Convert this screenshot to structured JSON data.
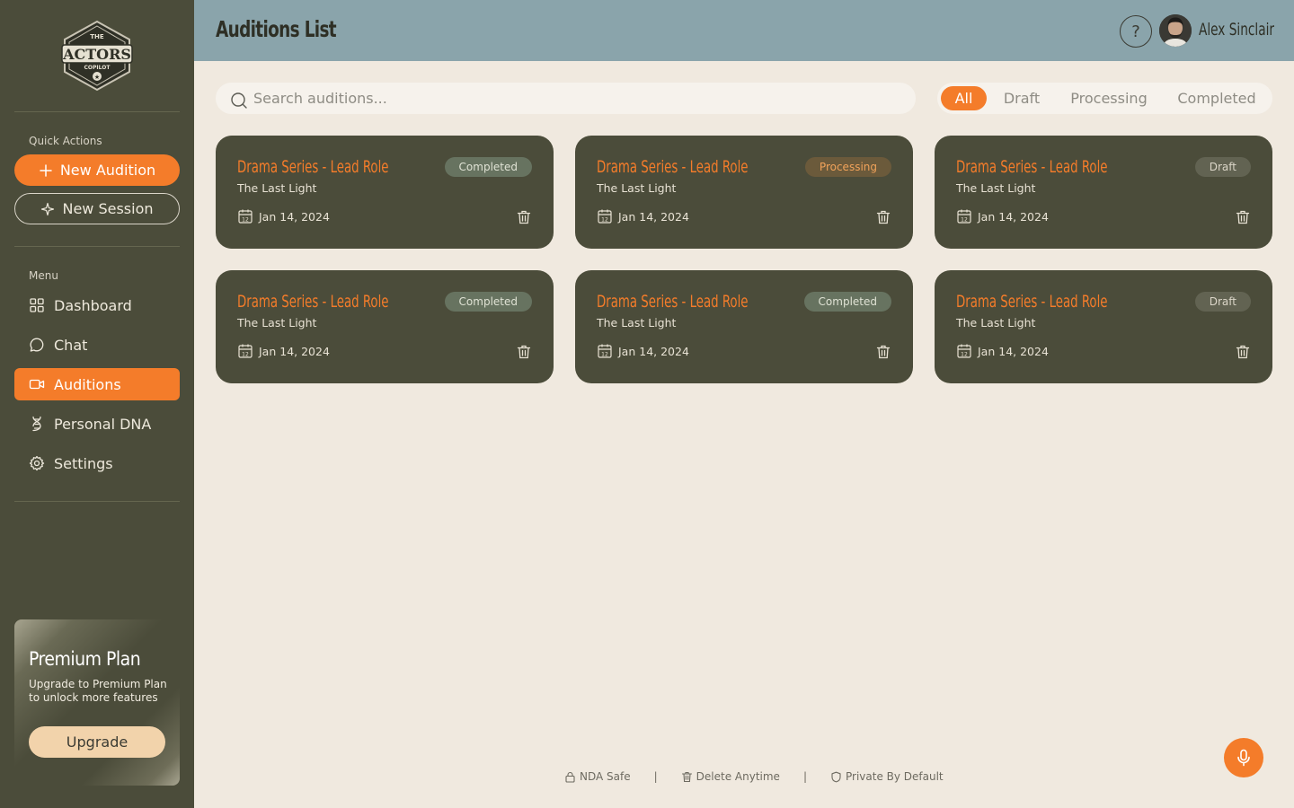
{
  "app": {
    "logo_text": {
      "top": "THE",
      "main": "ACTORS",
      "bottom": "COPILOT"
    }
  },
  "sidebar": {
    "quick_actions_label": "Quick Actions",
    "new_audition_label": "New Audition",
    "new_session_label": "New Session",
    "menu_label": "Menu",
    "items": [
      {
        "label": "Dashboard",
        "icon": "dashboard-icon",
        "active": false
      },
      {
        "label": "Chat",
        "icon": "chat-icon",
        "active": false
      },
      {
        "label": "Auditions",
        "icon": "video-icon",
        "active": true
      },
      {
        "label": "Personal DNA",
        "icon": "dna-icon",
        "active": false
      },
      {
        "label": "Settings",
        "icon": "gear-icon",
        "active": false
      }
    ],
    "premium": {
      "title": "Premium Plan",
      "description": "Upgrade to Premium Plan to unlock more features",
      "button_label": "Upgrade"
    }
  },
  "header": {
    "title": "Auditions List",
    "help_label": "?",
    "user_name": "Alex Sinclair"
  },
  "search": {
    "placeholder": "Search auditions..."
  },
  "filters": [
    {
      "label": "All",
      "active": true
    },
    {
      "label": "Draft",
      "active": false
    },
    {
      "label": "Processing",
      "active": false
    },
    {
      "label": "Completed",
      "active": false
    }
  ],
  "auditions": [
    {
      "title": "Drama Series - Lead Role",
      "subtitle": "The Last Light",
      "date": "Jan 14, 2024",
      "status": "Completed"
    },
    {
      "title": "Drama Series - Lead Role",
      "subtitle": "The Last Light",
      "date": "Jan 14, 2024",
      "status": "Processing"
    },
    {
      "title": "Drama Series - Lead Role",
      "subtitle": "The Last Light",
      "date": "Jan 14, 2024",
      "status": "Draft"
    },
    {
      "title": "Drama Series - Lead Role",
      "subtitle": "The Last Light",
      "date": "Jan 14, 2024",
      "status": "Completed"
    },
    {
      "title": "Drama Series - Lead Role",
      "subtitle": "The Last Light",
      "date": "Jan 14, 2024",
      "status": "Completed"
    },
    {
      "title": "Drama Series - Lead Role",
      "subtitle": "The Last Light",
      "date": "Jan 14, 2024",
      "status": "Draft"
    }
  ],
  "footer": {
    "items": [
      {
        "label": "NDA Safe",
        "icon": "lock-icon"
      },
      {
        "label": "Delete Anytime",
        "icon": "trash-icon"
      },
      {
        "label": "Private By Default",
        "icon": "shield-icon"
      }
    ],
    "separator": "|"
  },
  "colors": {
    "sidebar_bg": "#4b4c3a",
    "accent": "#f47c2a",
    "header_bg": "#8aa4ab",
    "page_bg": "#f0e9df",
    "card_bg": "#4b4c3a"
  }
}
